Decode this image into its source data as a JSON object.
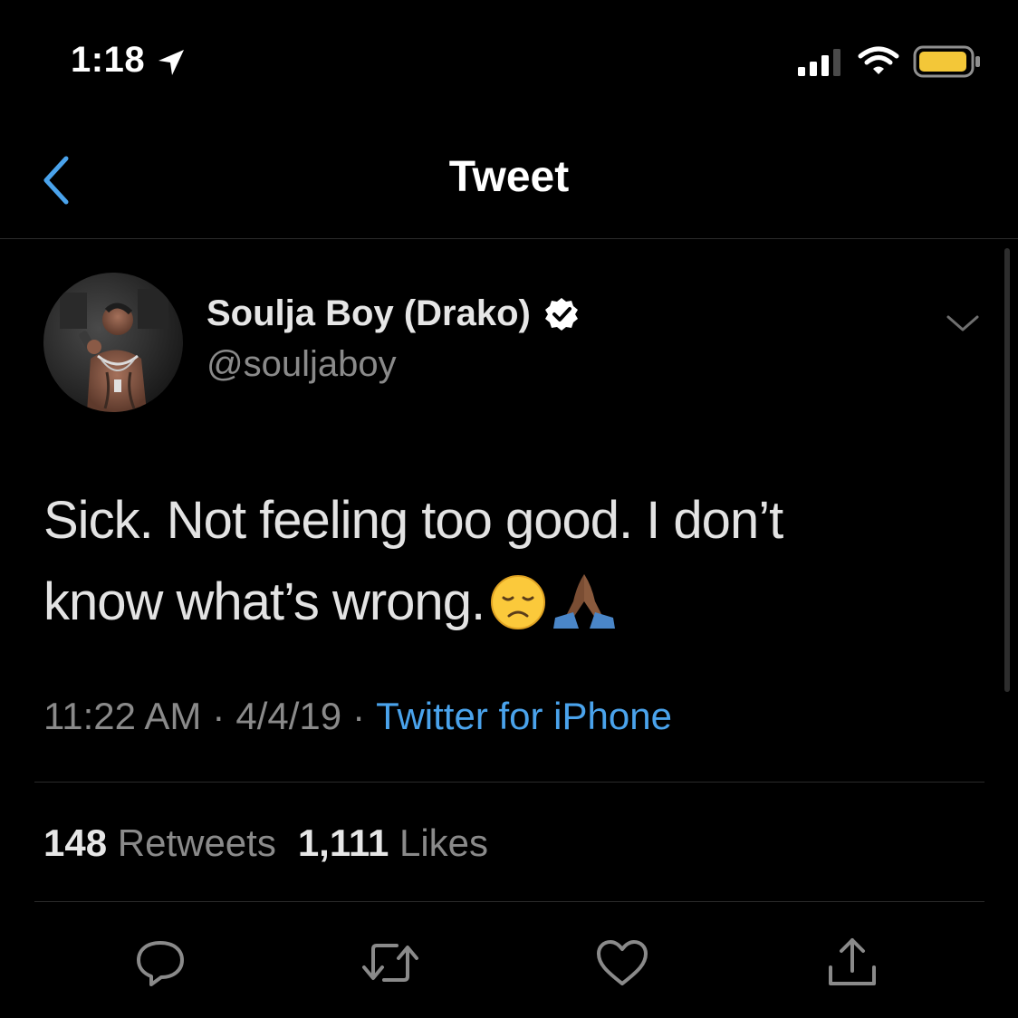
{
  "status_bar": {
    "time": "1:18",
    "battery_color": "#f3c738"
  },
  "nav": {
    "title": "Tweet",
    "back_icon": "chevron-left-icon"
  },
  "author": {
    "display_name": "Soulja Boy (Drako)",
    "handle": "@souljaboy",
    "verified": true
  },
  "tweet": {
    "text_line1": "Sick. Not feeling too good. I don’t",
    "text_line2": "know what’s wrong.",
    "emoji_1": "disappointed-face",
    "emoji_2": "folded-hands-dark-skin"
  },
  "meta": {
    "time": "11:22 AM",
    "separator": "·",
    "date": "4/4/19",
    "source": "Twitter for iPhone"
  },
  "stats": {
    "retweets_count": "148",
    "retweets_label": "Retweets",
    "likes_count": "1,111",
    "likes_label": "Likes"
  },
  "actions": {
    "reply_icon": "reply-icon",
    "retweet_icon": "retweet-icon",
    "like_icon": "heart-icon",
    "share_icon": "share-icon"
  },
  "colors": {
    "background": "#000000",
    "accent_link": "#4aa3ec",
    "muted_text": "#8a8a8a",
    "primary_text": "#e6e6e6",
    "divider": "#2b2b2b"
  }
}
